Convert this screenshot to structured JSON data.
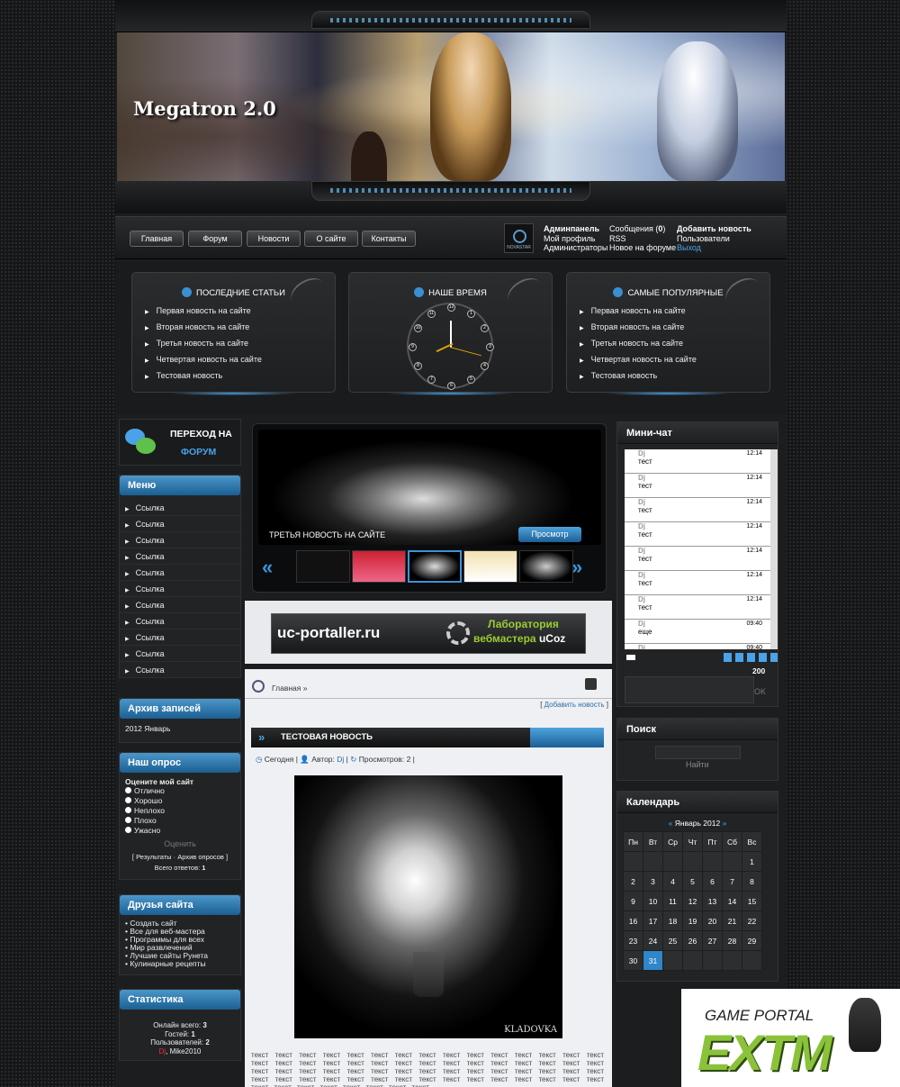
{
  "header": {
    "site_title": "Megatron 2.0"
  },
  "nav": [
    "Главная",
    "Форум",
    "Новости",
    "О сайте",
    "Контакты"
  ],
  "user_panel": {
    "logo_text": "NOVASTAR",
    "col1": [
      "Админпанель",
      "Мой профиль",
      "Администраторы"
    ],
    "col2_messages": "Сообщения (",
    "col2_count": "0",
    "col2_close": ")",
    "col2": [
      "RSS",
      "Новое на форуме"
    ],
    "col3": [
      "Добавить новость",
      "Пользователи",
      "Выход"
    ]
  },
  "panels": {
    "latest": {
      "title": "ПОСЛЕДНИЕ СТАТЬИ",
      "items": [
        "Первая новость на сайте",
        "Вторая новость на сайте",
        "Третья новость на сайте",
        "Четвертая новость на сайте",
        "Тестовая новость"
      ]
    },
    "time": {
      "title": "НАШЕ ВРЕМЯ",
      "numbers": [
        "12",
        "1",
        "2",
        "3",
        "4",
        "5",
        "6",
        "7",
        "8",
        "9",
        "10",
        "11"
      ]
    },
    "popular": {
      "title": "САМЫЕ ПОПУЛЯРНЫЕ",
      "items": [
        "Первая новость на сайте",
        "Вторая новость на сайте",
        "Третья новость на сайте",
        "Четвертая новость на сайте",
        "Тестовая новость"
      ]
    }
  },
  "forum_link": {
    "line1": "ПЕРЕХОД НА",
    "line2": "ФОРУМ"
  },
  "menu": {
    "title": "Меню",
    "items": [
      "Ссылка",
      "Ссылка",
      "Ссылка",
      "Ссылка",
      "Ссылка",
      "Ссылка",
      "Ссылка",
      "Ссылка",
      "Ссылка",
      "Ссылка",
      "Ссылка"
    ]
  },
  "archive": {
    "title": "Архив записей",
    "item": "2012 Январь"
  },
  "poll": {
    "title": "Наш опрос",
    "question": "Оцените мой сайт",
    "options": [
      "Отлично",
      "Хорошо",
      "Неплохо",
      "Плохо",
      "Ужасно"
    ],
    "button": "Оценить",
    "results": "Результаты",
    "archive": "Архив опросов",
    "total_label": "Всего ответов:",
    "total": "1"
  },
  "friends": {
    "title": "Друзья сайта",
    "items": [
      "Создать сайт",
      "Все для веб-мастера",
      "Программы для всех",
      "Мир развлечений",
      "Лучшие сайты Рунета",
      "Кулинарные рецепты"
    ]
  },
  "stats": {
    "title": "Статистика",
    "online_label": "Онлайн всего:",
    "online": "3",
    "guests_label": "Гостей:",
    "guests": "1",
    "users_label": "Пользователей:",
    "users": "2",
    "names_a": "Dj",
    "names_b": "Mike2010"
  },
  "slider": {
    "caption": "ТРЕТЬЯ НОВОСТЬ НА САЙТЕ",
    "button": "Просмотр"
  },
  "ad": {
    "domain": "uc-portaller.ru",
    "lab1": "Лаборатория",
    "lab2": "вебмастера",
    "lab3": "uCoz"
  },
  "breadcrumb": "Главная »",
  "add_news": "Добавить новость",
  "news": {
    "title": "ТЕСТОВАЯ НОВОСТЬ",
    "date": "Сегодня",
    "author_label": "Автор:",
    "author": "Dj",
    "views_label": "Просмотров:",
    "views": "2",
    "image_sign": "KLADOVKA",
    "body": "текст текст текст текст текст текст текст текст текст текст текст текст текст текст текст текст текст текст текст текст текст текст текст текст текст текст текст текст текст текст текст текст текст текст текст текст текст текст текст текст текст текст текст текст текст текст текст текст текст текст текст текст текст текст текст текст текст текст текст текст текст текст текст текст текст текст текст текст"
  },
  "minichat": {
    "title": "Мини-чат",
    "messages": [
      {
        "user": "Dj",
        "time": "12:14",
        "text": "тест"
      },
      {
        "user": "Dj",
        "time": "12:14",
        "text": "тест"
      },
      {
        "user": "Dj",
        "time": "12:14",
        "text": "тест"
      },
      {
        "user": "Dj",
        "time": "12:14",
        "text": "тест"
      },
      {
        "user": "Dj",
        "time": "12:14",
        "text": "тест"
      },
      {
        "user": "Dj",
        "time": "12:14",
        "text": "тест"
      },
      {
        "user": "Dj",
        "time": "12:14",
        "text": "тест"
      },
      {
        "user": "Dj",
        "time": "09:40",
        "text": "еще"
      },
      {
        "user": "Dj",
        "time": "09:40",
        "text": ""
      }
    ],
    "counter": "200",
    "ok": "OK"
  },
  "search": {
    "title": "Поиск",
    "button": "Найти"
  },
  "calendar": {
    "title": "Календарь",
    "prev": "«",
    "month": "Январь 2012",
    "next": "»",
    "days": [
      "Пн",
      "Вт",
      "Ср",
      "Чт",
      "Пт",
      "Сб",
      "Вс"
    ],
    "weeks": [
      [
        "",
        "",
        "",
        "",
        "",
        "",
        "1"
      ],
      [
        "2",
        "3",
        "4",
        "5",
        "6",
        "7",
        "8"
      ],
      [
        "9",
        "10",
        "11",
        "12",
        "13",
        "14",
        "15"
      ],
      [
        "16",
        "17",
        "18",
        "19",
        "20",
        "21",
        "22"
      ],
      [
        "23",
        "24",
        "25",
        "26",
        "27",
        "28",
        "29"
      ],
      [
        "30",
        "31",
        "",
        "",
        "",
        "",
        ""
      ]
    ],
    "today": "31"
  },
  "game_portal": {
    "line1": "GAME PORTAL",
    "line2": "EXTM"
  },
  "colors": {
    "accent": "#2f86c8",
    "dark": "#1c1d1f"
  }
}
